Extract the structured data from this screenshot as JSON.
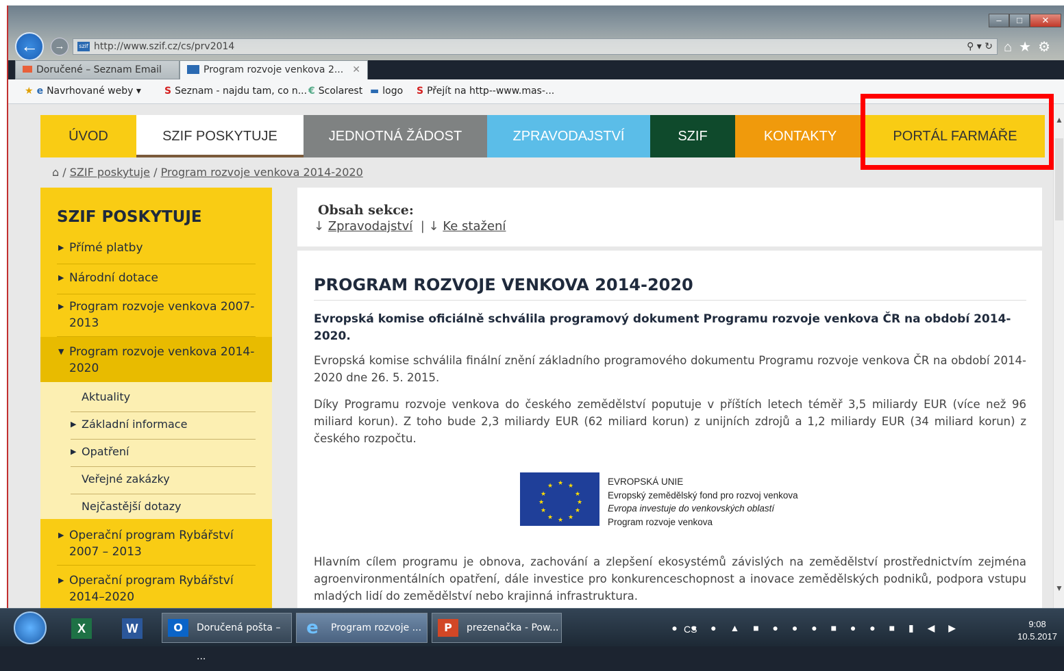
{
  "browser": {
    "url": "http://www.szif.cz/cs/prv2014",
    "tabs": [
      {
        "label": "Doručené – Seznam Email"
      },
      {
        "label": "Program rozvoje venkova 2...",
        "close": "✕"
      }
    ],
    "favorites": [
      {
        "label": "Navrhované weby ▾"
      },
      {
        "label": "Seznam - najdu tam, co n..."
      },
      {
        "label": "Scolarest"
      },
      {
        "label": "logo"
      },
      {
        "label": "Přejít na http--www.mas-..."
      }
    ]
  },
  "nav": [
    {
      "label": "ÚVOD",
      "bg": "#f9cc14",
      "color": "#333333"
    },
    {
      "label": "SZIF POSKYTUJE",
      "bg": "#ffffff",
      "color": "#333333"
    },
    {
      "label": "JEDNOTNÁ ŽÁDOST",
      "bg": "#7f8282",
      "color": "#ffffff"
    },
    {
      "label": "ZPRAVODAJSTVÍ",
      "bg": "#5bbde8",
      "color": "#ffffff"
    },
    {
      "label": "SZIF",
      "bg": "#0f4a2c",
      "color": "#ffffff"
    },
    {
      "label": "KONTAKTY",
      "bg": "#f09a0c",
      "color": "#ffffff"
    },
    {
      "label": "PORTÁL FARMÁŘE",
      "bg": "#f9cc14",
      "color": "#333333"
    }
  ],
  "breadcrumb": {
    "home_icon": "home-icon",
    "sep": "/",
    "items": [
      "SZIF poskytuje",
      "Program rozvoje venkova 2014-2020"
    ]
  },
  "sidebar": {
    "title": "SZIF POSKYTUJE",
    "items": [
      "Přímé platby",
      "Národní dotace",
      "Program rozvoje venkova 2007-2013",
      "Program rozvoje venkova 2014-2020"
    ],
    "subitems": [
      "Aktuality",
      "Základní informace",
      "Opatření",
      "Veřejné zakázky",
      "Nejčastější dotazy"
    ],
    "bottom_items": [
      "Operační program Rybářství 2007 – 2013",
      "Operační program Rybářství 2014–2020"
    ]
  },
  "section_contents": {
    "label": "Obsah sekce:",
    "links": [
      "Zpravodajství",
      "Ke stažení"
    ],
    "arrow": "↓",
    "sep": "|"
  },
  "article": {
    "title": "PROGRAM ROZVOJE VENKOVA 2014-2020",
    "lead": "Evropská komise oficiálně schválila programový dokument Programu rozvoje venkova ČR na období 2014-2020.",
    "p1": "Evropská komise schválila finální znění základního programového dokumentu Programu rozvoje venkova ČR na období 2014-2020 dne 26. 5. 2015.",
    "p2": "Díky Programu rozvoje venkova do českého zemědělství poputuje v příštích letech téměř 3,5 miliardy EUR (více než 96 miliard korun). Z toho bude 2,3 miliardy EUR (62 miliard korun) z unijních zdrojů a 1,2 miliardy EUR (34 miliard korun) z českého rozpočtu.",
    "eu_lines": [
      "EVROPSKÁ UNIE",
      "Evropský zemědělský fond pro rozvoj venkova",
      "Evropa investuje do venkovských oblastí",
      "Program rozvoje venkova"
    ],
    "p3": "Hlavním cílem programu je obnova, zachování a zlepšení ekosystémů závislých na zemědělství prostřednictvím zejména agroenvironmentálních opatření, dále investice pro konkurenceschopnost a inovace zemědělských podniků, podpora vstupu mladých lidí do zemědělství nebo krajinná infrastruktura."
  },
  "taskbar": {
    "buttons": [
      "Doručená pošta – ...",
      "Program rozvoje ...",
      "prezenačka - Pow..."
    ],
    "lang": "CS",
    "time": "9:08",
    "date": "10.5.2017"
  }
}
